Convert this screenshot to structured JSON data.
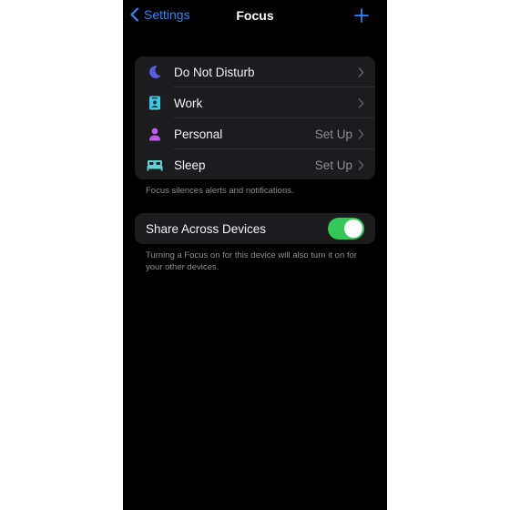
{
  "navbar": {
    "back_label": "Settings",
    "title": "Focus",
    "add_icon": "plus-icon"
  },
  "focus_modes": [
    {
      "label": "Do Not Disturb",
      "value": "",
      "icon": "moon-icon",
      "icon_color": "#5e5ce6"
    },
    {
      "label": "Work",
      "value": "",
      "icon": "id-badge-icon",
      "icon_color": "#40c8e0"
    },
    {
      "label": "Personal",
      "value": "Set Up",
      "icon": "person-icon",
      "icon_color": "#bf5af2"
    },
    {
      "label": "Sleep",
      "value": "Set Up",
      "icon": "bed-icon",
      "icon_color": "#64d2d2"
    }
  ],
  "focus_footnote": "Focus silences alerts and notifications.",
  "share": {
    "label": "Share Across Devices",
    "enabled": true,
    "toggle_color": "#34c759",
    "footnote": "Turning a Focus on for this device will also turn it on for your other devices."
  },
  "colors": {
    "accent": "#2f86f6",
    "background": "#000000",
    "cell": "#1c1c1e",
    "secondary_text": "#8d8d93"
  }
}
